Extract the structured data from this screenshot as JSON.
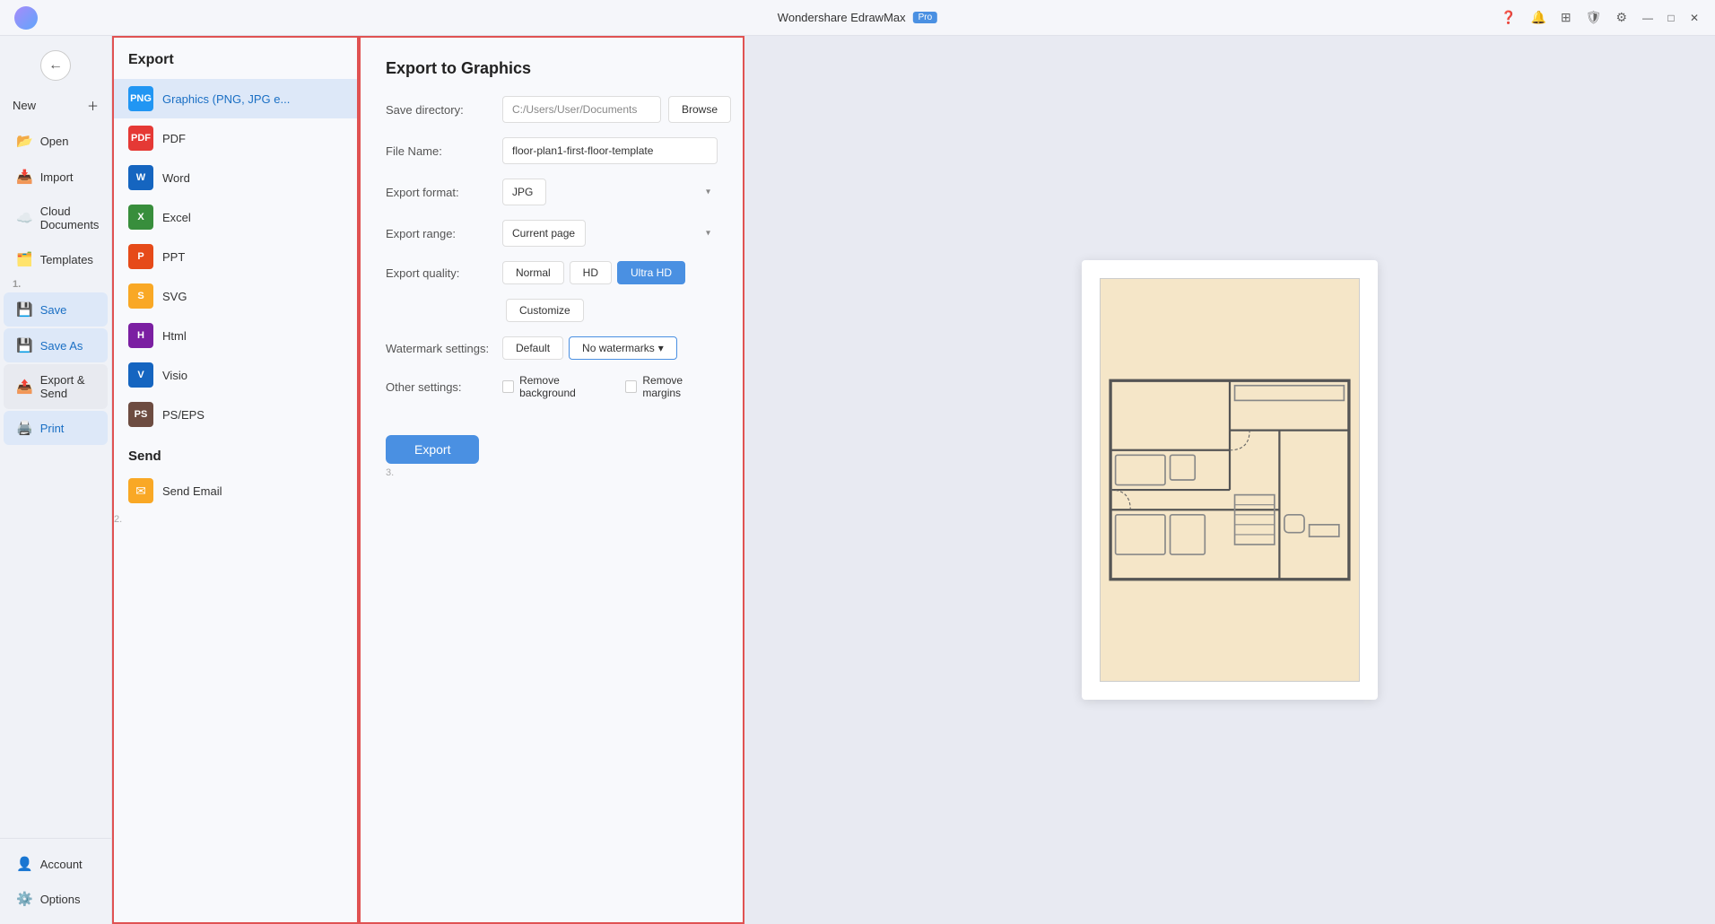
{
  "titlebar": {
    "title": "Wondershare EdrawMax",
    "pro_label": "Pro",
    "controls": {
      "minimize": "—",
      "maximize": "□",
      "close": "✕"
    }
  },
  "sidebar": {
    "items": [
      {
        "id": "new",
        "label": "New",
        "icon": "➕"
      },
      {
        "id": "open",
        "label": "Open",
        "icon": "📂"
      },
      {
        "id": "import",
        "label": "Import",
        "icon": "📥"
      },
      {
        "id": "cloud",
        "label": "Cloud Documents",
        "icon": "☁️"
      },
      {
        "id": "templates",
        "label": "Templates",
        "icon": "🗂️"
      },
      {
        "id": "save",
        "label": "Save",
        "icon": "💾"
      },
      {
        "id": "save-as",
        "label": "Save As",
        "icon": "💾"
      },
      {
        "id": "export",
        "label": "Export & Send",
        "icon": "📤"
      },
      {
        "id": "print",
        "label": "Print",
        "icon": "🖨️"
      }
    ],
    "account_label": "Account",
    "options_label": "Options"
  },
  "export_panel": {
    "title": "Export",
    "formats": [
      {
        "id": "png",
        "label": "Graphics (PNG, JPG e...",
        "icon_class": "icon-png",
        "icon_text": "PNG"
      },
      {
        "id": "pdf",
        "label": "PDF",
        "icon_class": "icon-pdf",
        "icon_text": "PDF"
      },
      {
        "id": "word",
        "label": "Word",
        "icon_class": "icon-word",
        "icon_text": "W"
      },
      {
        "id": "excel",
        "label": "Excel",
        "icon_class": "icon-excel",
        "icon_text": "X"
      },
      {
        "id": "ppt",
        "label": "PPT",
        "icon_class": "icon-ppt",
        "icon_text": "P"
      },
      {
        "id": "svg",
        "label": "SVG",
        "icon_class": "icon-svg",
        "icon_text": "S"
      },
      {
        "id": "html",
        "label": "Html",
        "icon_class": "icon-html",
        "icon_text": "H"
      },
      {
        "id": "visio",
        "label": "Visio",
        "icon_class": "icon-visio",
        "icon_text": "V"
      },
      {
        "id": "pseps",
        "label": "PS/EPS",
        "icon_class": "icon-pseps",
        "icon_text": "PS"
      }
    ],
    "send_section": "Send",
    "send_email": "Send Email"
  },
  "export_settings": {
    "title": "Export to Graphics",
    "save_directory_label": "Save directory:",
    "save_directory_value": "C:/Users/User/Documents",
    "browse_label": "Browse",
    "file_name_label": "File Name:",
    "file_name_value": "floor-plan1-first-floor-template",
    "export_format_label": "Export format:",
    "export_format_value": "JPG",
    "export_range_label": "Export range:",
    "export_range_value": "Current page",
    "export_quality_label": "Export quality:",
    "quality_normal": "Normal",
    "quality_hd": "HD",
    "quality_ultrahd": "Ultra HD",
    "customize_label": "Customize",
    "watermark_label": "Watermark settings:",
    "watermark_default": "Default",
    "watermark_no": "No watermarks",
    "other_settings_label": "Other settings:",
    "remove_background": "Remove background",
    "remove_margins": "Remove margins",
    "export_btn": "Export"
  },
  "step_labels": {
    "s1": "1.",
    "s2": "2.",
    "s3": "3."
  }
}
